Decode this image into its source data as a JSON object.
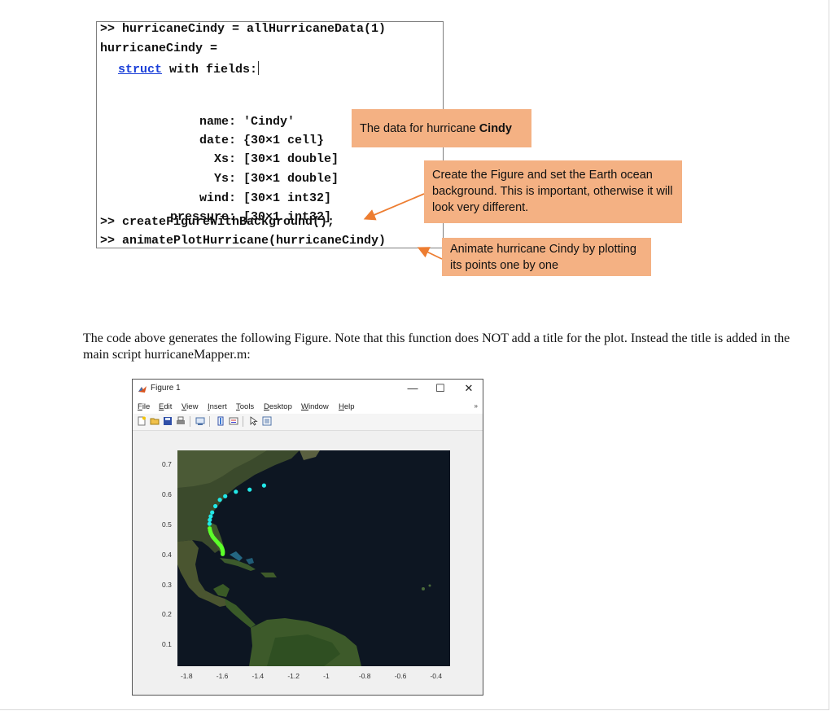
{
  "console": {
    "line1": ">> hurricaneCindy = allHurricaneData(1)",
    "line2": "hurricaneCindy =",
    "struct_link": "struct",
    "struct_rest": " with fields:",
    "fields": [
      {
        "name": "name:",
        "value": "'Cindy'"
      },
      {
        "name": "date:",
        "value": "{30×1 cell}"
      },
      {
        "name": "Xs:",
        "value": "[30×1 double]"
      },
      {
        "name": "Ys:",
        "value": "[30×1 double]"
      },
      {
        "name": "wind:",
        "value": "[30×1 int32]"
      },
      {
        "name": "pressure:",
        "value": "[30×1 int32]"
      }
    ],
    "cmd1": ">> createFigureWithBackground();",
    "cmd2": ">> animatePlotHurricane(hurricaneCindy)"
  },
  "callouts": {
    "data_prefix": "The data for hurricane ",
    "data_bold": "Cindy",
    "figure": "Create the Figure and set the Earth ocean background.  This is important, otherwise it will look very different.",
    "animate": "Animate hurricane Cindy by plotting its points one by one"
  },
  "paragraph": "The code above generates the following Figure.  Note that this function does NOT add a title for the plot.  Instead the title is added in the main script hurricaneMapper.m:",
  "figure_window": {
    "title": "Figure 1",
    "minimize": "—",
    "maximize": "☐",
    "close": "✕",
    "menus": [
      {
        "first": "F",
        "rest": "ile"
      },
      {
        "first": "E",
        "rest": "dit"
      },
      {
        "first": "V",
        "rest": "iew"
      },
      {
        "first": "I",
        "rest": "nsert"
      },
      {
        "first": "T",
        "rest": "ools"
      },
      {
        "first": "D",
        "rest": "esktop"
      },
      {
        "first": "W",
        "rest": "indow"
      },
      {
        "first": "H",
        "rest": "elp"
      }
    ],
    "menu_overflow": "»",
    "toolbar_icons": [
      "new-figure-icon",
      "open-file-icon",
      "save-icon",
      "print-icon",
      "link-plot-icon",
      "insert-colorbar-icon",
      "insert-legend-icon",
      "edit-plot-icon",
      "property-inspector-icon"
    ]
  },
  "colors": {
    "callout_bg": "#f4b183",
    "arrow": "#ed7d31",
    "struct_link": "#1a3fd8",
    "cyan_points": "#22e8e8",
    "green_points": "#5cff2a"
  },
  "chart_data": {
    "type": "scatter",
    "title": "",
    "xlabel": "",
    "ylabel": "",
    "xlim": [
      -1.85,
      -0.32
    ],
    "ylim": [
      0.03,
      0.75
    ],
    "xticks": [
      "-1.8",
      "-1.6",
      "-1.4",
      "-1.2",
      "-1",
      "-0.8",
      "-0.6",
      "-0.4"
    ],
    "yticks": [
      "0.7",
      "0.6",
      "0.5",
      "0.4",
      "0.3",
      "0.2",
      "0.1"
    ],
    "background": "Earth ocean satellite image",
    "series": [
      {
        "color": "#22e8e8",
        "x": [
          -1.364,
          -1.445,
          -1.522,
          -1.582,
          -1.612,
          -1.637,
          -1.655,
          -1.663,
          -1.668,
          -1.67
        ],
        "y": [
          0.633,
          0.619,
          0.612,
          0.597,
          0.585,
          0.564,
          0.543,
          0.53,
          0.518,
          0.505
        ]
      },
      {
        "color": "#5cff2a",
        "x": [
          -1.669,
          -1.667,
          -1.664,
          -1.66,
          -1.655,
          -1.65,
          -1.644,
          -1.638,
          -1.632,
          -1.626,
          -1.62,
          -1.614,
          -1.608,
          -1.604,
          -1.6,
          -1.598,
          -1.596,
          -1.595,
          -1.595,
          -1.596
        ],
        "y": [
          0.49,
          0.483,
          0.477,
          0.471,
          0.465,
          0.46,
          0.456,
          0.452,
          0.448,
          0.444,
          0.44,
          0.436,
          0.432,
          0.428,
          0.424,
          0.42,
          0.416,
          0.412,
          0.408,
          0.404
        ]
      }
    ]
  }
}
